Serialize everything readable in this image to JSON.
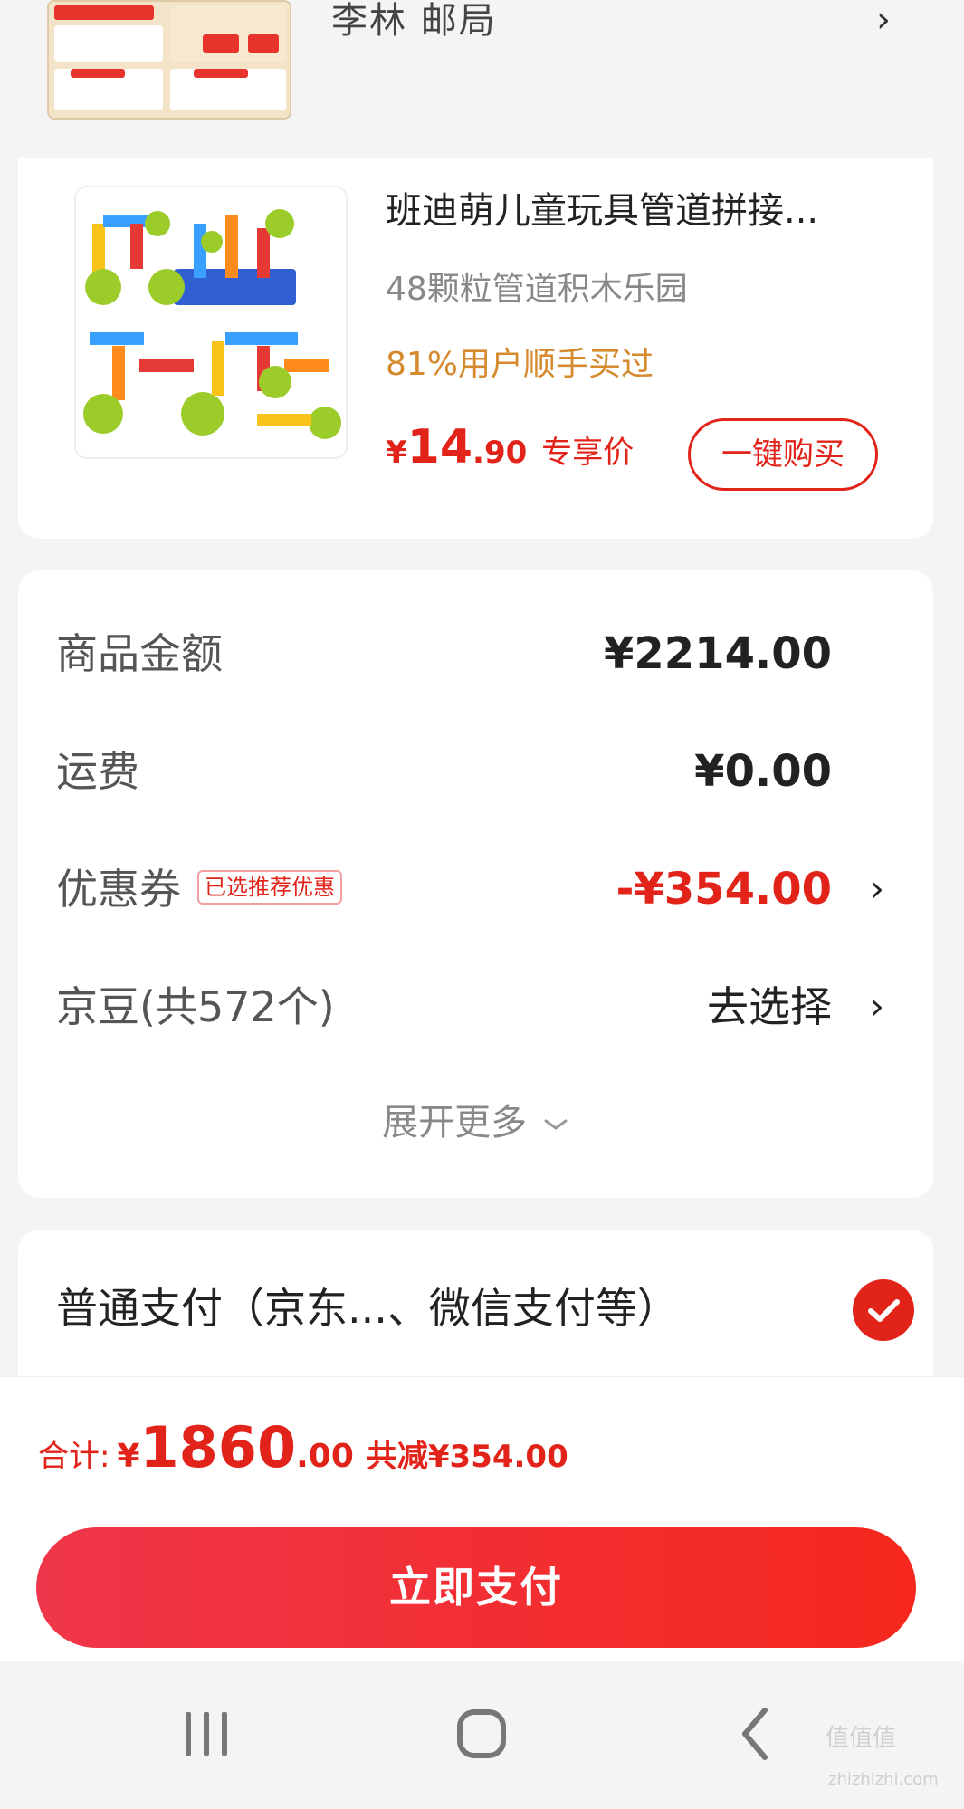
{
  "address": {
    "text": "李林  邮局",
    "chevron": "›"
  },
  "product": {
    "title": "班迪萌儿童玩具管道拼接...",
    "subtitle": "48颗粒管道积木乐园",
    "rate": "81%用户顺手买过",
    "price_currency": "¥",
    "price_int": "14",
    "price_dec": ".90",
    "price_label": "专享价",
    "buy_label": "一键购买"
  },
  "summary": {
    "rows": [
      {
        "label": "商品金额",
        "value": "¥2214.00"
      },
      {
        "label": "运费",
        "value": "¥0.00"
      },
      {
        "label": "优惠券",
        "badge": "已选推荐优惠",
        "value": "-¥354.00",
        "chevron": "›"
      },
      {
        "label": "京豆(共572个)",
        "value": "去选择",
        "chevron": "›"
      }
    ],
    "expand_label": "展开更多",
    "expand_icon": "chevron-down-icon"
  },
  "payment": {
    "label": "普通支付（京东...、微信支付等）",
    "icon": "check-icon"
  },
  "total": {
    "label": "合计:",
    "currency": "¥",
    "int": "1860",
    "dec": ".00",
    "saving": "共减¥354.00"
  },
  "pay_button": {
    "label": "立即支付"
  },
  "nav": {
    "icons": [
      "recent-apps-icon",
      "home-icon",
      "back-icon"
    ]
  },
  "watermark": {
    "text": "值值值",
    "domain": "zhizhizhi.com"
  },
  "colors": {
    "accent": "#e2231a",
    "rate": "#d58a2e",
    "background": "#f4f4f4"
  }
}
